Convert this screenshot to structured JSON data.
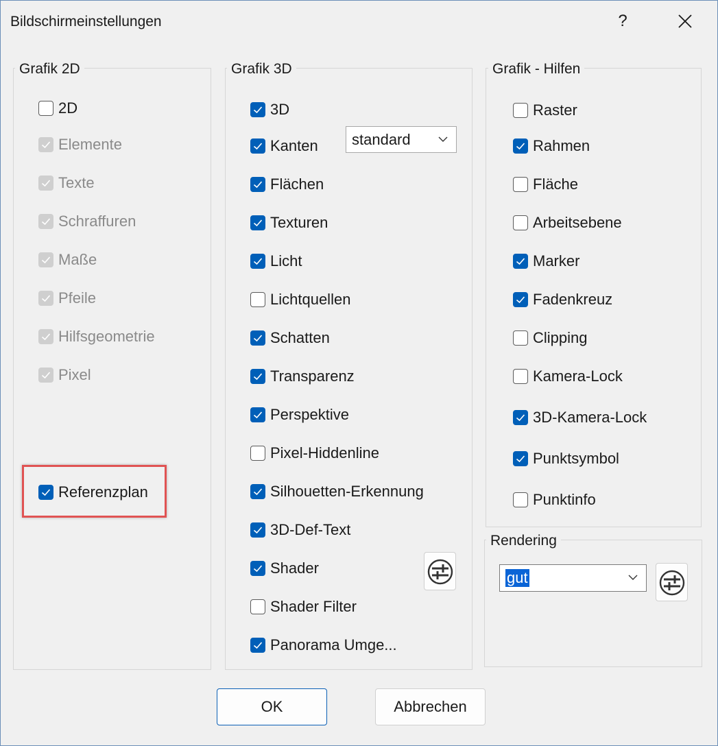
{
  "window": {
    "title": "Bildschirmeinstellungen",
    "help": "?"
  },
  "grafik2d": {
    "label": "Grafik 2D",
    "items": [
      {
        "label": "2D",
        "checked": false,
        "disabled": false
      },
      {
        "label": "Elemente",
        "checked": true,
        "disabled": true
      },
      {
        "label": "Texte",
        "checked": true,
        "disabled": true
      },
      {
        "label": "Schraffuren",
        "checked": true,
        "disabled": true
      },
      {
        "label": "Maße",
        "checked": true,
        "disabled": true
      },
      {
        "label": "Pfeile",
        "checked": true,
        "disabled": true
      },
      {
        "label": "Hilfsgeometrie",
        "checked": true,
        "disabled": true
      },
      {
        "label": "Pixel",
        "checked": true,
        "disabled": true
      }
    ],
    "referenzplan": {
      "label": "Referenzplan",
      "checked": true
    }
  },
  "grafik3d": {
    "label": "Grafik 3D",
    "items": [
      {
        "label": "3D",
        "checked": true
      },
      {
        "label": "Kanten",
        "checked": true
      },
      {
        "label": "Flächen",
        "checked": true
      },
      {
        "label": "Texturen",
        "checked": true
      },
      {
        "label": "Licht",
        "checked": true
      },
      {
        "label": "Lichtquellen",
        "checked": false
      },
      {
        "label": "Schatten",
        "checked": true
      },
      {
        "label": "Transparenz",
        "checked": true
      },
      {
        "label": "Perspektive",
        "checked": true
      },
      {
        "label": "Pixel-Hiddenline",
        "checked": false
      },
      {
        "label": "Silhouetten-Erkennung",
        "checked": true
      },
      {
        "label": "3D-Def-Text",
        "checked": true
      },
      {
        "label": "Shader",
        "checked": true
      },
      {
        "label": "Shader Filter",
        "checked": false
      },
      {
        "label": "Panorama Umge...",
        "checked": true
      }
    ],
    "kanten_select": "standard"
  },
  "hilfen": {
    "label": "Grafik - Hilfen",
    "items": [
      {
        "label": "Raster",
        "checked": false
      },
      {
        "label": "Rahmen",
        "checked": true
      },
      {
        "label": "Fläche",
        "checked": false
      },
      {
        "label": "Arbeitsebene",
        "checked": false
      },
      {
        "label": "Marker",
        "checked": true
      },
      {
        "label": "Fadenkreuz",
        "checked": true
      },
      {
        "label": "Clipping",
        "checked": false
      },
      {
        "label": "Kamera-Lock",
        "checked": false
      },
      {
        "label": "3D-Kamera-Lock",
        "checked": true
      },
      {
        "label": "Punktsymbol",
        "checked": true
      },
      {
        "label": "Punktinfo",
        "checked": false
      }
    ]
  },
  "rendering": {
    "label": "Rendering",
    "value": "gut"
  },
  "buttons": {
    "ok": "OK",
    "cancel": "Abbrechen"
  },
  "colors": {
    "accent": "#005fb8",
    "highlight": "#e05353"
  }
}
